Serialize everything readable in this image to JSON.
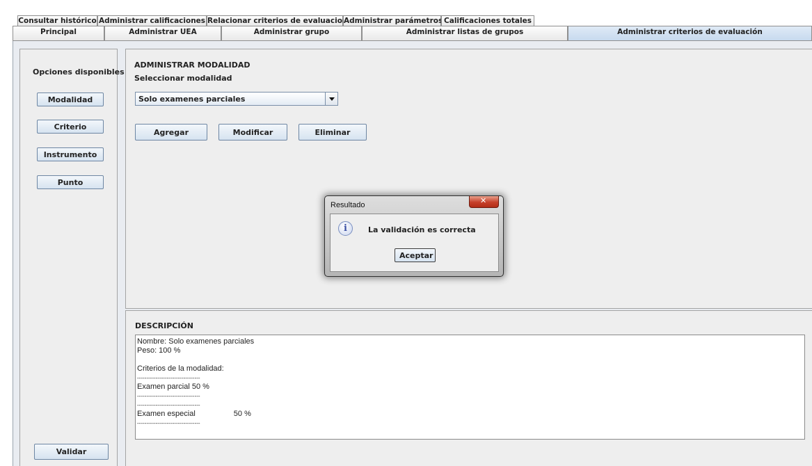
{
  "tabs": {
    "row1": [
      "Consultar histórico",
      "Administrar calificaciones",
      "Relacionar criterios de evaluacion",
      "Administrar parámetros",
      "Calificaciones totales"
    ],
    "row2": [
      "Principal",
      "Administrar UEA",
      "Administrar grupo",
      "Administrar listas de grupos",
      "Administrar criterios de evaluación"
    ],
    "selected": "Administrar criterios de evaluación"
  },
  "sidebar": {
    "heading": "Opciones disponibles",
    "buttons": [
      "Modalidad",
      "Criterio",
      "Instrumento",
      "Punto"
    ],
    "validate": "Validar"
  },
  "modalidad": {
    "title": "ADMINISTRAR MODALIDAD",
    "select_label": "Seleccionar modalidad",
    "selected": "Solo examenes parciales",
    "buttons": {
      "add": "Agregar",
      "edit": "Modificar",
      "delete": "Eliminar"
    }
  },
  "description": {
    "title": "DESCRIPCIÓN",
    "lines": [
      "Nombre: Solo examenes parciales",
      "Peso: 100 %",
      "",
      "Criterios de la modalidad:",
      "----------------------------------",
      "Examen parcial 50 %",
      "----------------------------------",
      "----------------------------------",
      "Examen especial                  50 %",
      "----------------------------------"
    ]
  },
  "dialog": {
    "title": "Resultado",
    "message": "La validación es correcta",
    "button": "Aceptar"
  },
  "colors": {
    "selected_tab": "#c6d9ee",
    "button_border": "#6d86a3",
    "close_button": "#c6402a",
    "info_icon": "#3a4fa3"
  }
}
